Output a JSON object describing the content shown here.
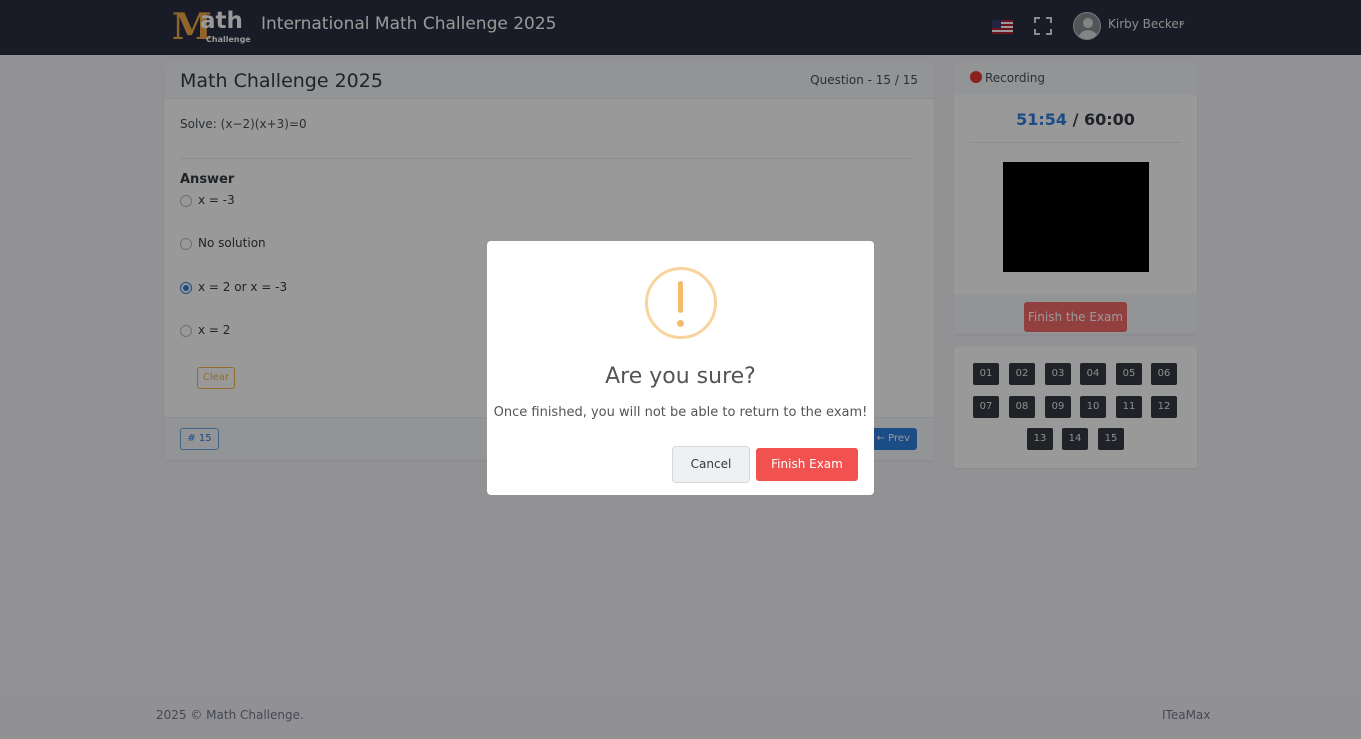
{
  "header": {
    "logo": {
      "letter": "M",
      "rest": "ath",
      "sub": "Challenge"
    },
    "app_title": "International Math Challenge 2025",
    "user_name": "Kirby Becker",
    "language_icon": "us-flag-icon",
    "fullscreen_icon": "fullscreen-icon",
    "dropdown_icon": "chevron-down-icon"
  },
  "question_card": {
    "title": "Math Challenge 2025",
    "counter": "Question - 15 / 15",
    "question_text": "Solve: (x−2)(x+3)=0",
    "answer_label": "Answer",
    "options": [
      {
        "label": "x = -3",
        "selected": false
      },
      {
        "label": "No solution",
        "selected": false
      },
      {
        "label": "x = 2 or x = -3",
        "selected": true
      },
      {
        "label": "x = 2",
        "selected": false
      }
    ],
    "clear_label": "Clear",
    "question_number_badge": "# 15",
    "prev_label": "← Prev"
  },
  "recording": {
    "label": "Recording",
    "elapsed": "51:54",
    "total": "/ 60:00",
    "finish_label": "Finish the Exam"
  },
  "question_nav": {
    "buttons": [
      "01",
      "02",
      "03",
      "04",
      "05",
      "06",
      "07",
      "08",
      "09",
      "10",
      "11",
      "12",
      "13",
      "14",
      "15"
    ]
  },
  "footer": {
    "copyright": "2025 © Math Challenge.",
    "credit": "ITeaMax"
  },
  "modal": {
    "title": "Are you sure?",
    "message": "Once finished, you will not be able to return to the exam!",
    "cancel_label": "Cancel",
    "confirm_label": "Finish Exam",
    "icon": "warning-icon"
  },
  "colors": {
    "topbar": "#2a3042",
    "primary": "#2f7fe0",
    "danger": "#f46a6a",
    "warning": "#f1b44c"
  }
}
